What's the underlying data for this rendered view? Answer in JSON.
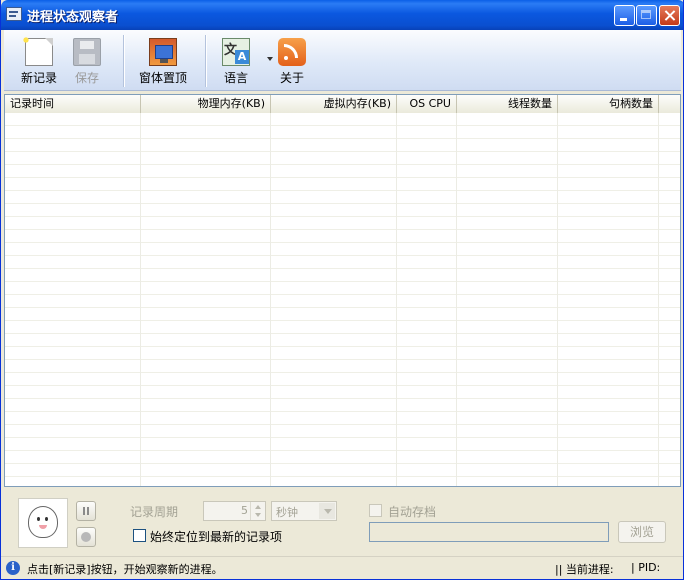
{
  "window": {
    "title": "进程状态观察者"
  },
  "toolbar": {
    "new_record": "新记录",
    "save": "保存",
    "window_topmost": "窗体置顶",
    "language": "语言",
    "about": "关于",
    "lang_icon_glyph_1": "文",
    "lang_icon_glyph_2": "A"
  },
  "table": {
    "columns": [
      "记录时间",
      "物理内存(KB)",
      "虚拟内存(KB)",
      "OS CPU",
      "线程数量",
      "句柄数量"
    ],
    "rows": []
  },
  "panel": {
    "period_label": "记录周期",
    "period_value": "5",
    "unit_value": "秒钟",
    "auto_save_label": "自动存档",
    "auto_save_checked": false,
    "always_locate_label": "始终定位到最新的记录项",
    "always_locate_checked": false,
    "path_value": "",
    "browse_label": "浏览"
  },
  "status": {
    "info_glyph": "i",
    "message": "点击[新记录]按钮，开始观察新的进程。",
    "current_process": "|| 当前进程:",
    "pid": "| PID:"
  }
}
